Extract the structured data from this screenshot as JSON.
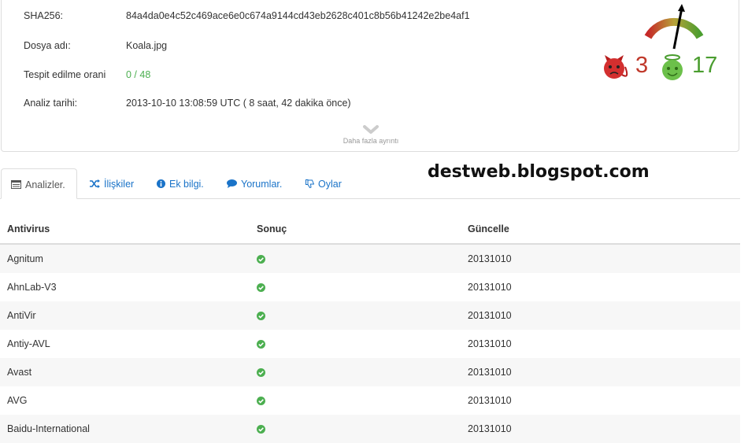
{
  "info": {
    "sha_label": "SHA256:",
    "sha_value": "84a4da0e4c52c469ace6e0c674a9144cd43eb2628c401c8b56b41242e2be4af1",
    "filename_label": "Dosya adı:",
    "filename_value": "Koala.jpg",
    "detection_label": "Tespit edilme orani",
    "detection_value": "0 / 48",
    "date_label": "Analiz tarihi:",
    "date_value": "2013-10-10 13:08:59 UTC ( 8 saat, 42 dakika önce)",
    "more_label": "Daha fazla ayrıntı"
  },
  "votes": {
    "malicious_count": "3",
    "harmless_count": "17",
    "malicious_icon": "devil-face-icon",
    "harmless_icon": "angel-face-icon",
    "colors": {
      "bad": "#c0392b",
      "good": "#4a9d2f"
    }
  },
  "watermark": "destweb.blogspot.com",
  "tabs": [
    {
      "label": "Analizler.",
      "icon": "list-icon",
      "active": true
    },
    {
      "label": "İlişkiler",
      "icon": "shuffle-icon",
      "active": false
    },
    {
      "label": "Ek bilgi.",
      "icon": "info-icon",
      "active": false
    },
    {
      "label": "Yorumlar.",
      "icon": "comment-icon",
      "active": false
    },
    {
      "label": "Oylar",
      "icon": "thumbs-down-icon",
      "active": false
    }
  ],
  "table": {
    "headers": [
      "Antivirus",
      "Sonuç",
      "Güncelle"
    ],
    "rows": [
      {
        "name": "Agnitum",
        "result": "check-icon",
        "update": "20131010"
      },
      {
        "name": "AhnLab-V3",
        "result": "check-icon",
        "update": "20131010"
      },
      {
        "name": "AntiVir",
        "result": "check-icon",
        "update": "20131010"
      },
      {
        "name": "Antiy-AVL",
        "result": "check-icon",
        "update": "20131010"
      },
      {
        "name": "Avast",
        "result": "check-icon",
        "update": "20131010"
      },
      {
        "name": "AVG",
        "result": "check-icon",
        "update": "20131010"
      },
      {
        "name": "Baidu-International",
        "result": "check-icon",
        "update": "20131010"
      }
    ]
  }
}
